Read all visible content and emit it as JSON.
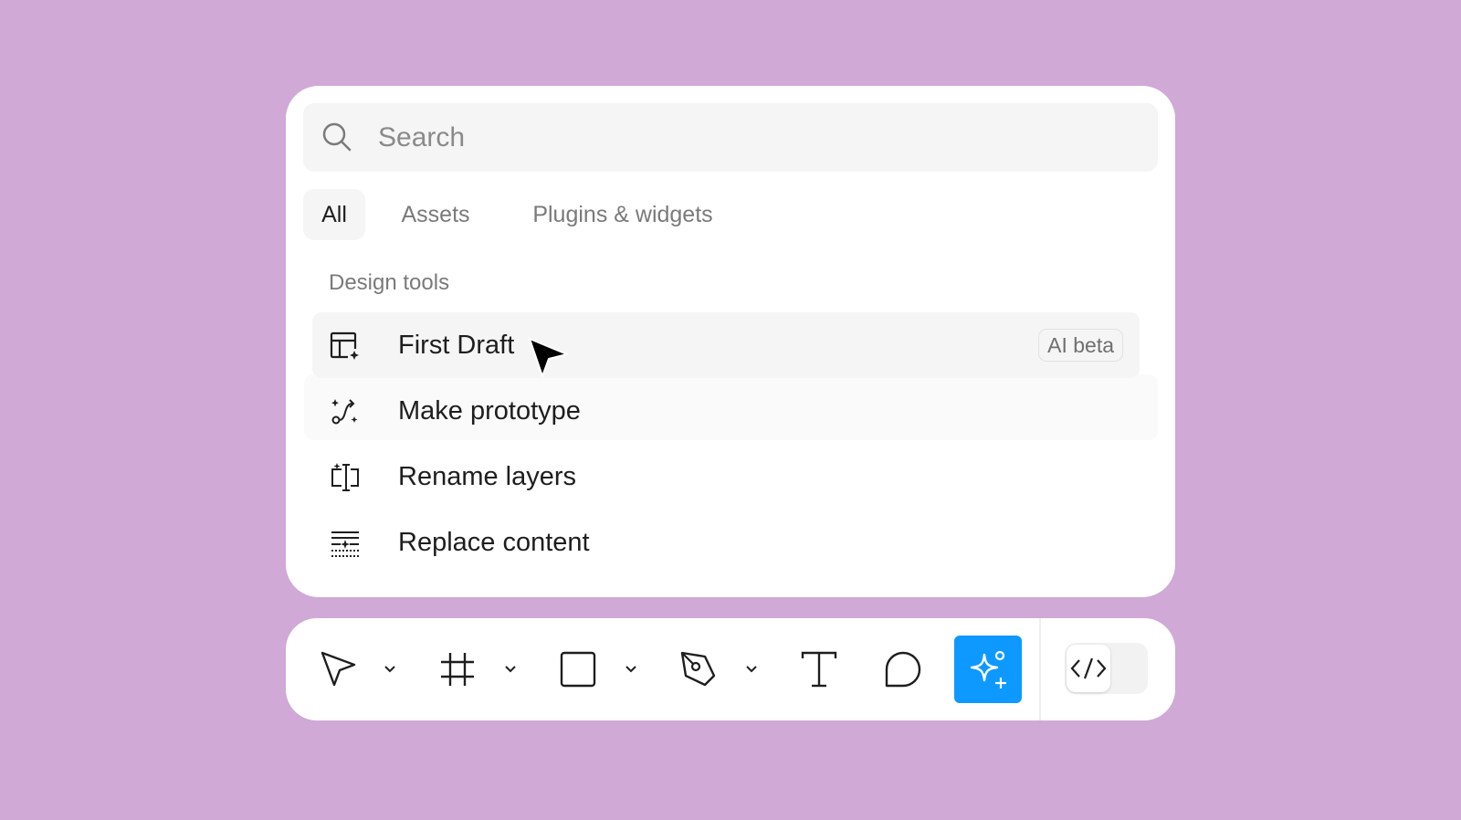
{
  "search": {
    "placeholder": "Search",
    "icon": "search-icon"
  },
  "tabs": [
    {
      "label": "All",
      "active": true
    },
    {
      "label": "Assets",
      "active": false
    },
    {
      "label": "Plugins & widgets",
      "active": false
    }
  ],
  "section": {
    "label": "Design tools"
  },
  "items": [
    {
      "label": "First Draft",
      "icon": "first-draft-icon",
      "badge": "AI beta",
      "highlighted": true
    },
    {
      "label": "Make prototype",
      "icon": "make-prototype-icon"
    },
    {
      "label": "Rename layers",
      "icon": "rename-layers-icon"
    },
    {
      "label": "Replace content",
      "icon": "replace-content-icon"
    }
  ],
  "toolbar": {
    "tools": [
      "move-icon",
      "frame-icon",
      "rectangle-icon",
      "pen-icon",
      "text-icon",
      "comment-icon",
      "ai-sparkle-icon"
    ],
    "dev_mode_icon": "code-icon",
    "accent": "#0d99ff"
  },
  "colors": {
    "background": "#d0a9d7",
    "panel": "#ffffff",
    "highlight": "#f5f5f5"
  }
}
